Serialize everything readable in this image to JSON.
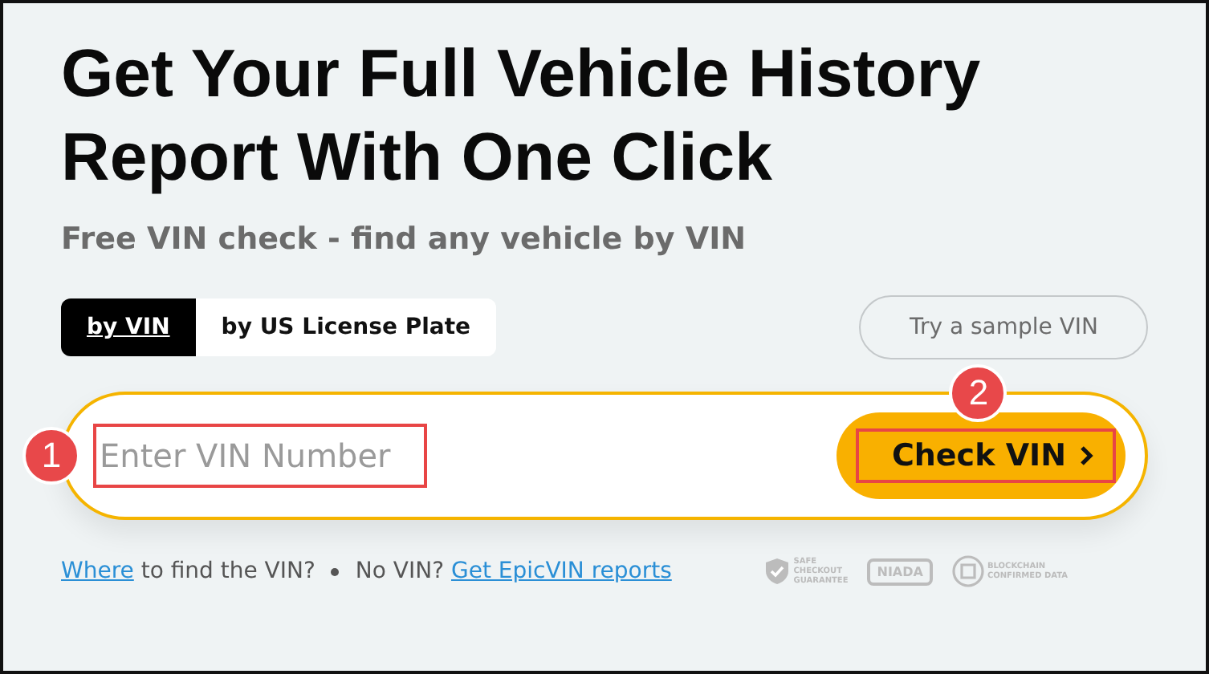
{
  "heading": "Get Your Full Vehicle History Report With One Click",
  "subheading": "Free VIN check - find any vehicle by VIN",
  "tabs": [
    {
      "label": "by VIN",
      "selected": true
    },
    {
      "label": "by US License Plate",
      "selected": false
    }
  ],
  "sample_button": "Try a sample VIN",
  "search": {
    "placeholder": "Enter VIN Number",
    "button": "Check VIN"
  },
  "annotations": [
    {
      "number": "1",
      "kind": "field"
    },
    {
      "number": "2",
      "kind": "button"
    }
  ],
  "footer": {
    "where_link": "Where",
    "where_text": "to find the VIN?",
    "no_vin_text": "No VIN?",
    "report_link": "Get EpicVIN reports"
  },
  "badges": [
    {
      "kind": "shield",
      "lines": [
        "SAFE",
        "CHECKOUT",
        "GUARANTEE"
      ]
    },
    {
      "kind": "niada",
      "lines": [
        "NIADA"
      ]
    },
    {
      "kind": "blockchain",
      "lines": [
        "BLOCKCHAIN",
        "CONFIRMED DATA"
      ]
    }
  ]
}
